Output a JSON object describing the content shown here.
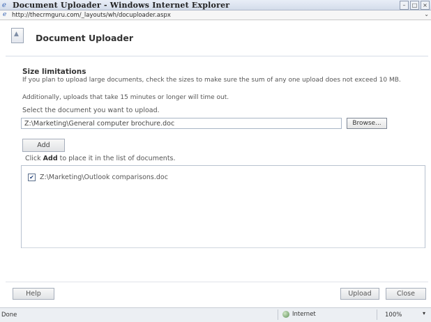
{
  "window": {
    "title": "Document Uploader - Windows Internet Explorer",
    "address": "http://thecrmguru.com/_layouts/wh/docuploader.aspx"
  },
  "header": {
    "title": "Document Uploader"
  },
  "size_limits": {
    "heading": "Size limitations",
    "text1": "If you plan to upload large documents, check the sizes to make sure the sum of any one upload does not exceed 10 MB.",
    "text2": "Additionally, uploads that take 15 minutes or longer will time out."
  },
  "form": {
    "select_label": "Select the document you want to upload.",
    "file_path": "Z:\\Marketing\\General computer brochure.doc",
    "browse_label": "Browse...",
    "add_label": "Add",
    "hint_prefix": "Click",
    "hint_bold": "Add",
    "hint_suffix": "to place it in the list of documents."
  },
  "documents": [
    {
      "checked": true,
      "label": "Z:\\Marketing\\Outlook comparisons.doc"
    }
  ],
  "footer": {
    "help_label": "Help",
    "upload_label": "Upload",
    "close_label": "Close"
  },
  "status": {
    "text": "Done",
    "zone": "Internet",
    "zoom": "100%"
  },
  "icons": {
    "title": "ie-icon",
    "address": "page-icon",
    "header": "document-upload-icon",
    "zone": "globe-icon"
  },
  "colors": {
    "titlebar": "#d3dcea",
    "border": "#b8c2d0",
    "statusbar": "#eceff3"
  }
}
